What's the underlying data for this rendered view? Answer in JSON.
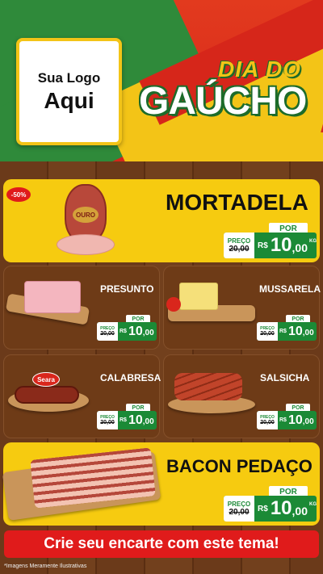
{
  "header": {
    "logo_line1": "Sua Logo",
    "logo_line2": "Aqui",
    "title_top": "DIA DO",
    "title_main": "GAÚCHO"
  },
  "discount_badge": "-50%",
  "products": [
    {
      "name": "MORTADELA",
      "brand": "OURO",
      "por_label": "POR",
      "preco_label": "PREÇO",
      "old_prefix": "DE",
      "old_price": "20,00",
      "currency": "R$",
      "price_int": "10",
      "price_dec": ",00",
      "unit": "KG"
    },
    {
      "name": "PRESUNTO",
      "por_label": "POR",
      "preco_label": "PREÇO",
      "old_prefix": "DE",
      "old_price": "20,00",
      "currency": "R$",
      "price_int": "10",
      "price_dec": ",00"
    },
    {
      "name": "MUSSARELA",
      "por_label": "POR",
      "preco_label": "PREÇO",
      "old_prefix": "DE",
      "old_price": "20,00",
      "currency": "R$",
      "price_int": "10",
      "price_dec": ",00"
    },
    {
      "name": "CALABRESA",
      "brand": "Seara",
      "por_label": "POR",
      "preco_label": "PREÇO",
      "old_prefix": "DE",
      "old_price": "20,00",
      "currency": "R$",
      "price_int": "10",
      "price_dec": ",00"
    },
    {
      "name": "SALSICHA",
      "por_label": "POR",
      "preco_label": "PREÇO",
      "old_prefix": "DE",
      "old_price": "20,00",
      "currency": "R$",
      "price_int": "10",
      "price_dec": ",00"
    },
    {
      "name": "BACON PEDAÇO",
      "por_label": "POR",
      "preco_label": "PREÇO",
      "old_prefix": "DE",
      "old_price": "20,00",
      "currency": "R$",
      "price_int": "10",
      "price_dec": ",00",
      "unit": "KG"
    }
  ],
  "cta": "Crie seu encarte com este tema!",
  "disclaimer": "*Imagens Meramente Ilustrativas",
  "colors": {
    "red": "#e01b1b",
    "green": "#1b8a36",
    "yellow": "#f6cb10",
    "brown": "#6e3b17"
  }
}
